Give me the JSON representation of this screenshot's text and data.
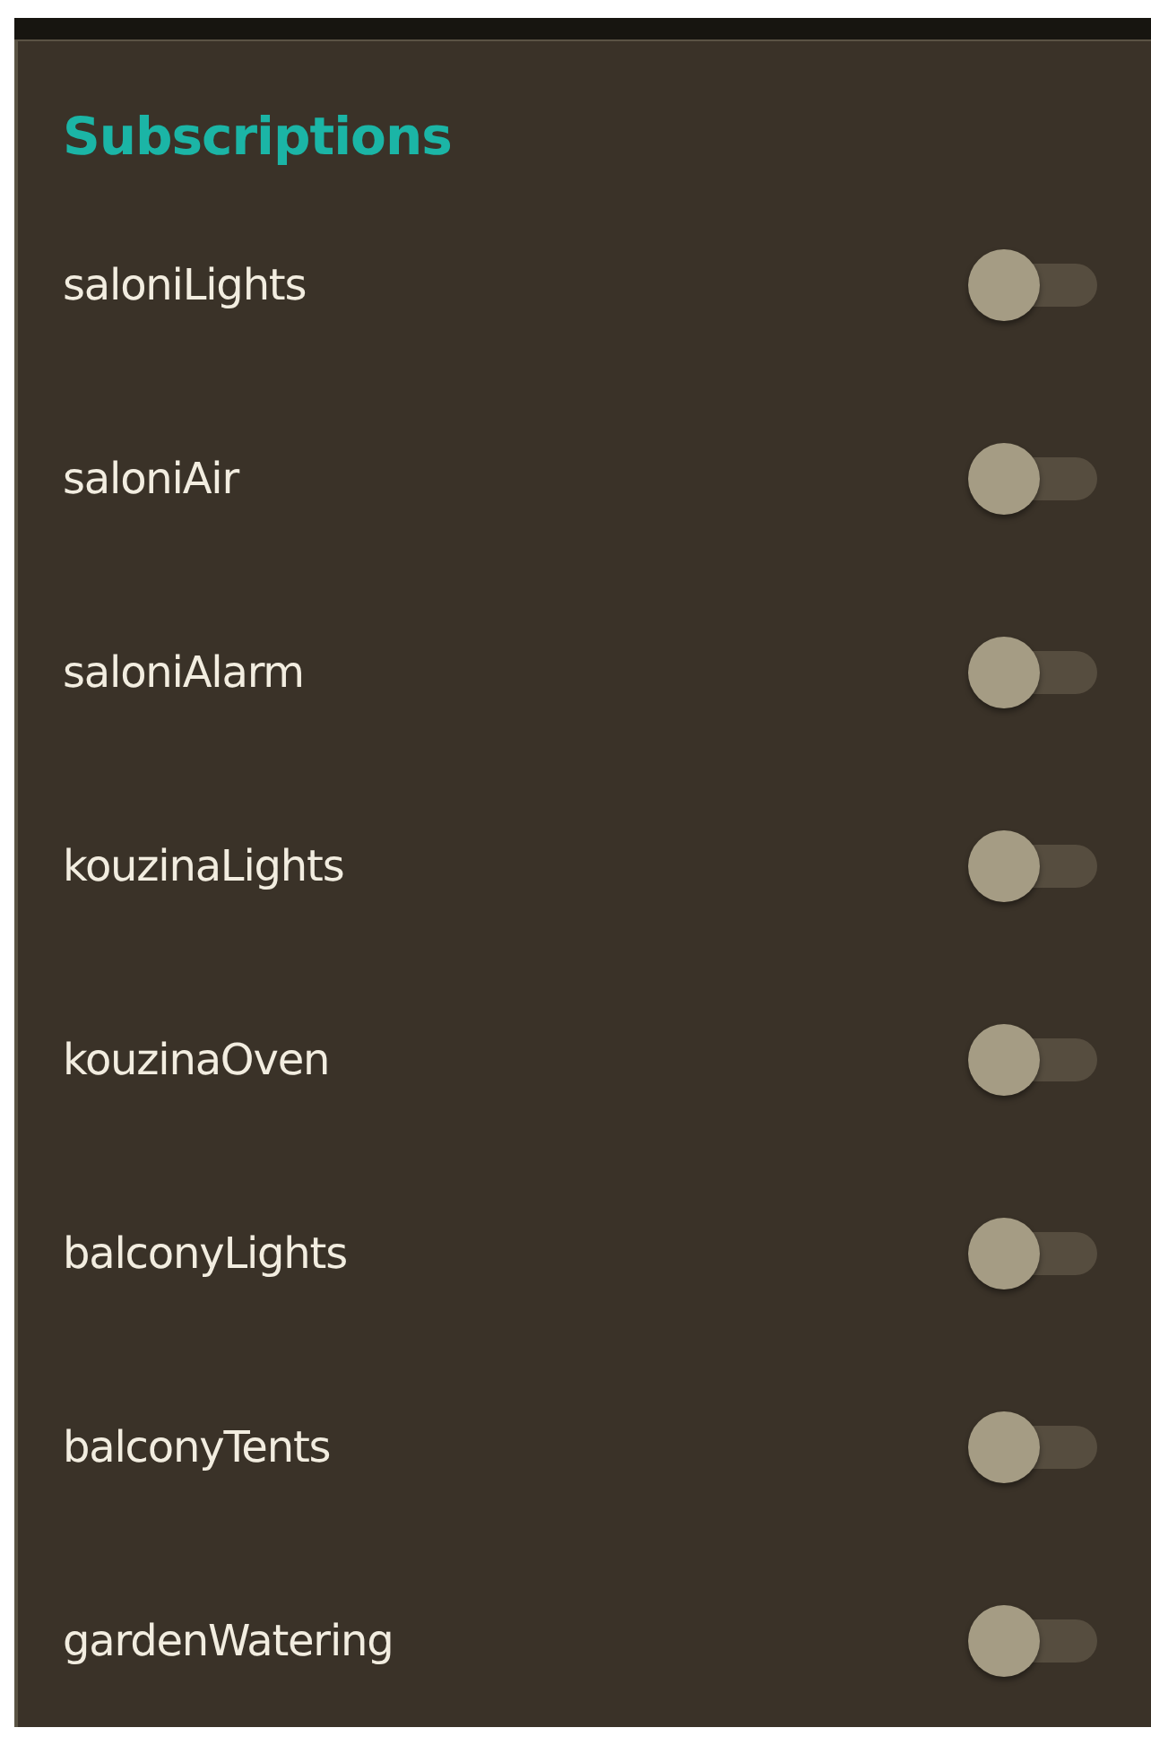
{
  "title": "Subscriptions",
  "subscriptions": [
    {
      "name": "saloniLights",
      "on": false
    },
    {
      "name": "saloniAir",
      "on": false
    },
    {
      "name": "saloniAlarm",
      "on": false
    },
    {
      "name": "kouzinaLights",
      "on": false
    },
    {
      "name": "kouzinaOven",
      "on": false
    },
    {
      "name": "balconyLights",
      "on": false
    },
    {
      "name": "balconyTents",
      "on": false
    },
    {
      "name": "gardenWatering",
      "on": false
    }
  ]
}
